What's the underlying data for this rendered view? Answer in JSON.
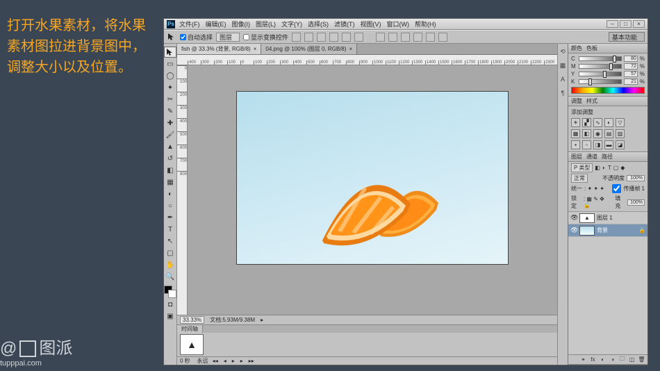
{
  "instruction_text": "打开水果素材，将水果素材图拉进背景图中，调整大小以及位置。",
  "watermark": {
    "logo": "图派",
    "url": "tupppai.com"
  },
  "menubar": [
    "文件(F)",
    "编辑(E)",
    "图像(I)",
    "图层(L)",
    "文字(Y)",
    "选择(S)",
    "滤镜(T)",
    "视图(V)",
    "窗口(W)",
    "帮助(H)"
  ],
  "options": {
    "auto_select": "自动选择",
    "group_dd": "图层",
    "show_transform": "显示变换控件",
    "workspace": "基本功能"
  },
  "doc_tabs": [
    {
      "label": "fish @ 33.3% (背景, RGB/8)",
      "active": true
    },
    {
      "label": "04.png @ 100% (图层 0, RGB/8)",
      "active": false
    }
  ],
  "ruler_marks": [
    "400",
    "300",
    "200",
    "100",
    "0",
    "100",
    "200",
    "300",
    "400",
    "500",
    "600",
    "700",
    "800",
    "900",
    "1000",
    "1100",
    "1200",
    "1300",
    "1400",
    "1500",
    "1600",
    "1700",
    "1800",
    "1900",
    "2000",
    "2100",
    "2200",
    "2300"
  ],
  "ruler_v": [
    "0",
    "100",
    "200",
    "300",
    "400",
    "500",
    "600",
    "700",
    "800"
  ],
  "status": {
    "zoom": "33.33%",
    "docinfo": "文档:5.93M/9.38M"
  },
  "timeline": {
    "tab": "时间轴",
    "duration": "0 秒",
    "loop": "永远"
  },
  "panels": {
    "color": {
      "tab1": "颜色",
      "tab2": "色板",
      "channels": [
        {
          "n": "C",
          "v": 80
        },
        {
          "n": "M",
          "v": 72
        },
        {
          "n": "Y",
          "v": 57
        },
        {
          "n": "K",
          "v": 21
        }
      ],
      "pct": "%"
    },
    "adjust": {
      "tab1": "调整",
      "tab2": "样式",
      "title": "添加调整"
    },
    "layers": {
      "tab1": "图层",
      "tab2": "通道",
      "tab3": "路径",
      "kind": "P 类型",
      "mode": "正常",
      "opacity_label": "不透明度",
      "opacity": "100%",
      "lock_label": "锁定",
      "fill_label": "填充",
      "fill": "100%",
      "unify": "统一",
      "propagate": "传播帧 1",
      "items": [
        {
          "name": "图层 1",
          "sel": false
        },
        {
          "name": "背景",
          "sel": true,
          "locked": true
        }
      ]
    }
  }
}
